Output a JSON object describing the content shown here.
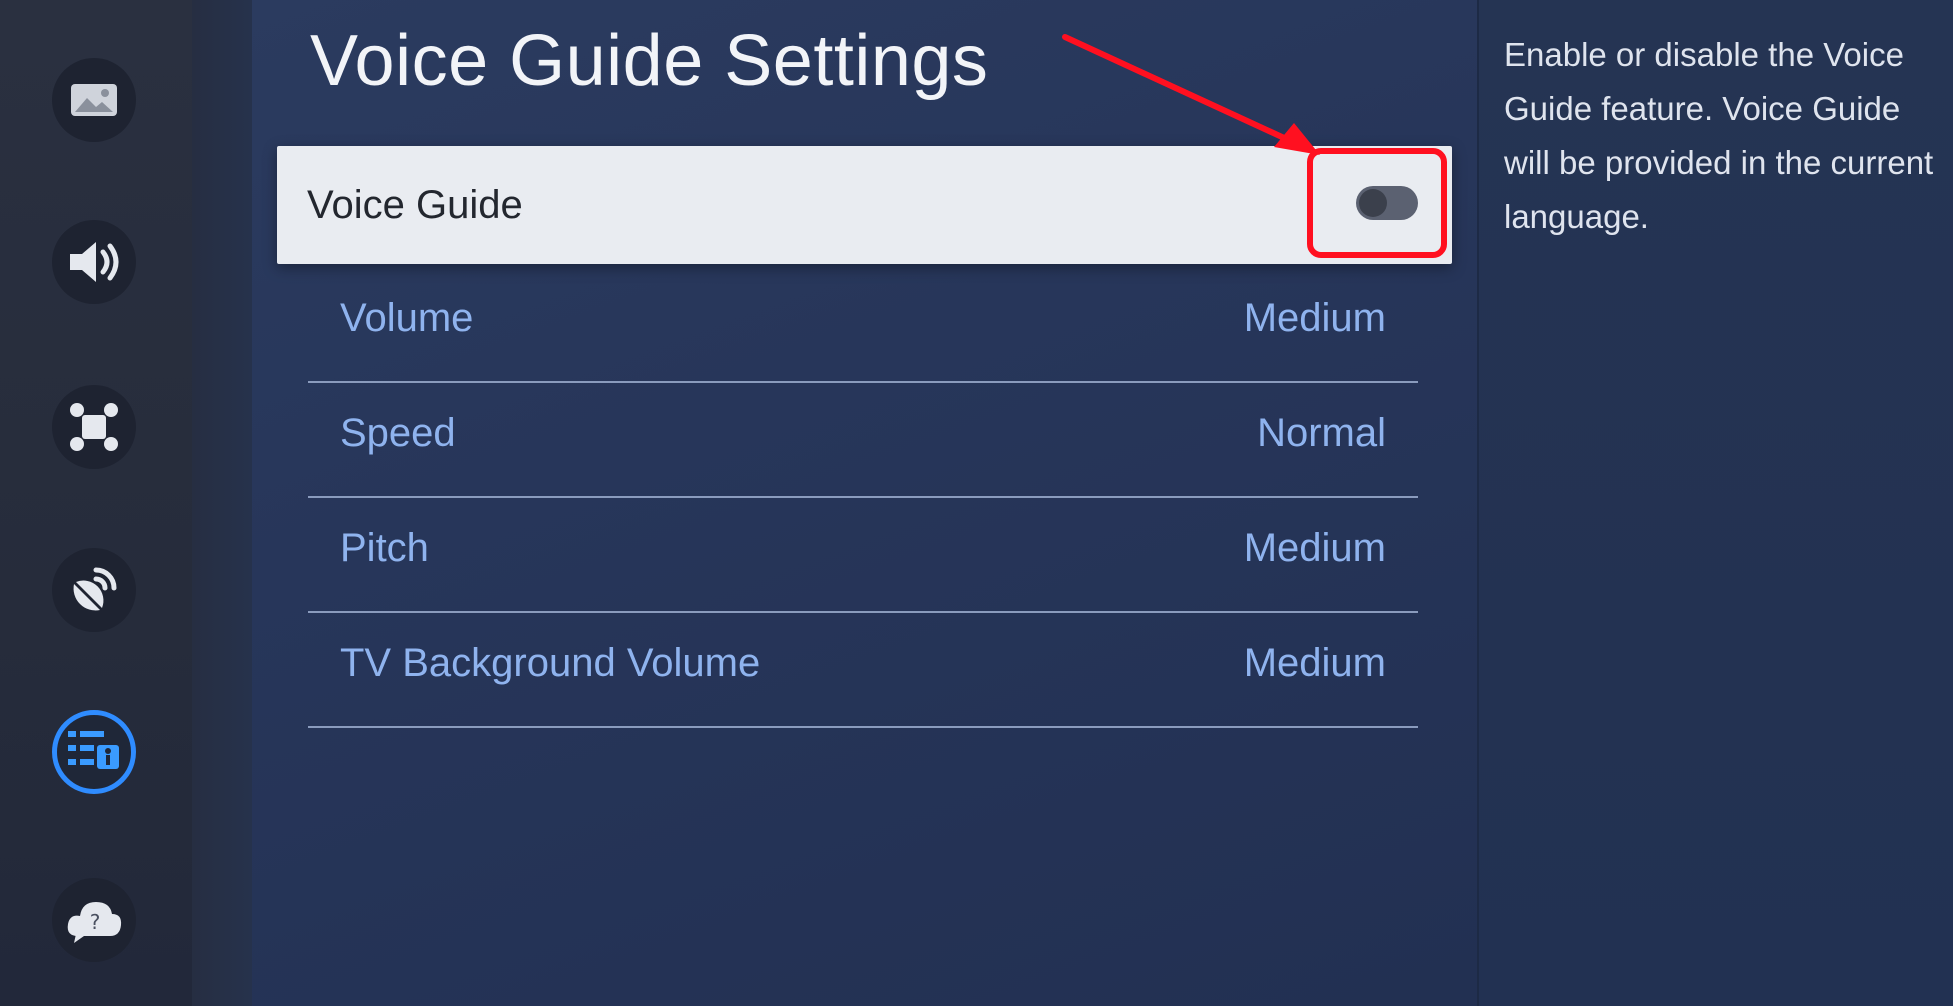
{
  "page": {
    "title": "Voice Guide Settings"
  },
  "voice_guide": {
    "label": "Voice Guide",
    "toggle_on": false
  },
  "settings": [
    {
      "name": "Volume",
      "value": "Medium"
    },
    {
      "name": "Speed",
      "value": "Normal"
    },
    {
      "name": "Pitch",
      "value": "Medium"
    },
    {
      "name": "TV Background Volume",
      "value": "Medium"
    }
  ],
  "description": "Enable or disable the Voice Guide feature. Voice Guide will be provided in the current language.",
  "rail_icons": [
    "picture-icon",
    "sound-icon",
    "connection-icon",
    "broadcast-icon",
    "accessibility-icon",
    "support-icon"
  ],
  "colors": {
    "accent": "#2f8cff",
    "annotation": "#ff1020",
    "row_text": "#8fb3ee"
  }
}
